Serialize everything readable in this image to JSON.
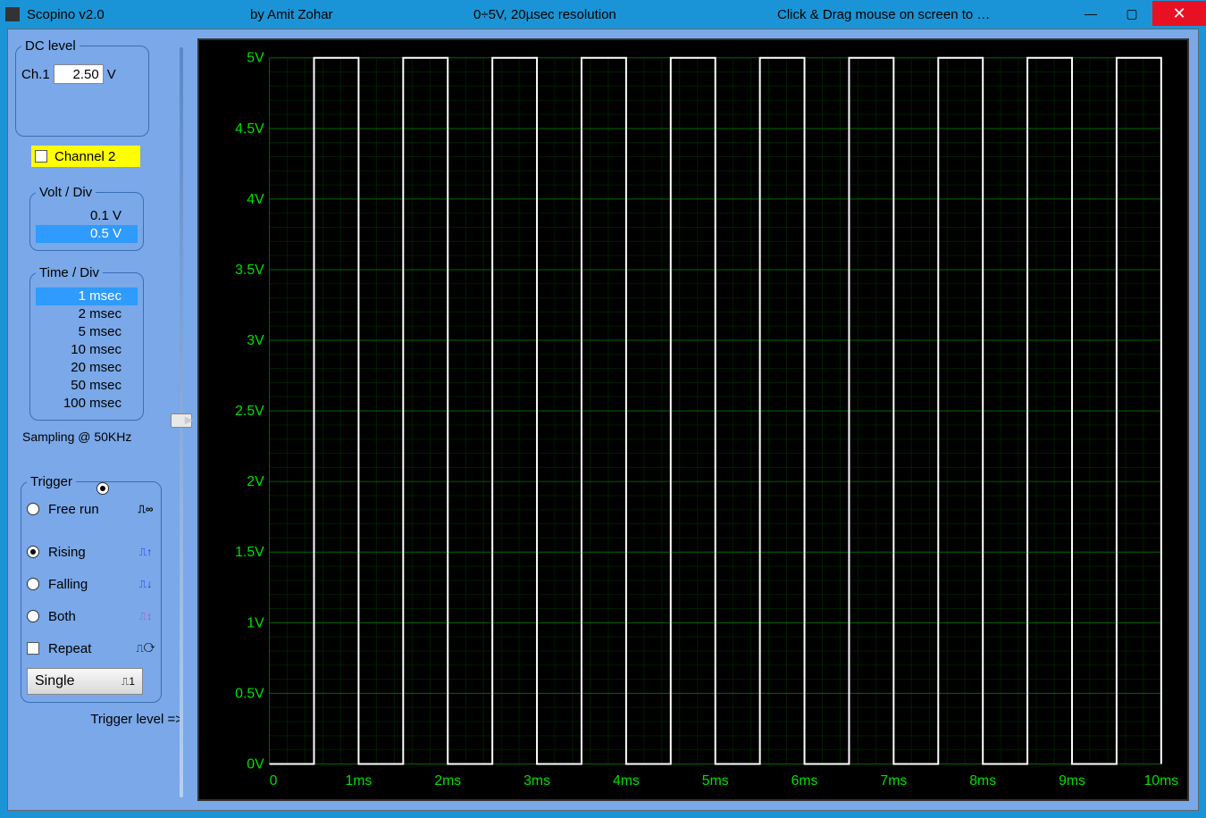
{
  "titlebar": {
    "app": "Scopino v2.0",
    "author": "by Amit Zohar",
    "res": "0÷5V, 20µsec resolution",
    "hint": "Click & Drag mouse on screen to …"
  },
  "dc": {
    "legend": "DC level",
    "ch_label": "Ch.1",
    "value": "2.50",
    "unit": "V"
  },
  "ch2": {
    "label": "Channel 2",
    "checked": false
  },
  "vdiv": {
    "legend": "Volt / Div",
    "options": [
      "0.1 V",
      "0.5 V"
    ],
    "selected": "0.5 V"
  },
  "tdiv": {
    "legend": "Time / Div",
    "options": [
      "1 msec",
      "2 msec",
      "5 msec",
      "10 msec",
      "20 msec",
      "50 msec",
      "100 msec"
    ],
    "selected": "1 msec"
  },
  "sampling": "Sampling @ 50KHz",
  "trigger": {
    "legend": "Trigger",
    "freerun": "Free run",
    "rising": "Rising",
    "falling": "Falling",
    "both": "Both",
    "repeat": "Repeat",
    "single": "Single",
    "selected": "Rising",
    "level_label": "Trigger level =>"
  },
  "slider": {
    "pos_fraction": 0.5
  },
  "chart_data": {
    "type": "line",
    "title": "",
    "xlabel": "",
    "ylabel": "",
    "y_ticks": [
      "5V",
      "4.5V",
      "4V",
      "3.5V",
      "3V",
      "2.5V",
      "2V",
      "1.5V",
      "1V",
      "0.5V",
      "0V"
    ],
    "x_ticks": [
      "0",
      "1ms",
      "2ms",
      "3ms",
      "4ms",
      "5ms",
      "6ms",
      "7ms",
      "8ms",
      "9ms",
      "10ms"
    ],
    "xlim": [
      0,
      10
    ],
    "ylim": [
      0,
      5
    ],
    "series": [
      {
        "name": "Ch1",
        "waveform": "square",
        "low": 0,
        "high": 5,
        "period_ms": 1.0,
        "duty": 0.5,
        "phase_ms": 0.5
      }
    ]
  }
}
